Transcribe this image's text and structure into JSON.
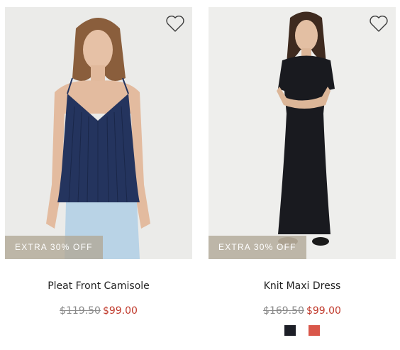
{
  "products": [
    {
      "badge": "EXTRA 30% OFF",
      "name": "Pleat Front Camisole",
      "original_price": "$119.50",
      "sale_price": "$99.00",
      "swatches": []
    },
    {
      "badge": "EXTRA 30% OFF",
      "name": "Knit Maxi Dress",
      "original_price": "$169.50",
      "sale_price": "$99.00",
      "swatches": [
        {
          "name": "black",
          "color": "#1d1f27"
        },
        {
          "name": "coral",
          "color": "#d9574a"
        }
      ]
    }
  ],
  "icons": {
    "wishlist": "heart-outline-icon"
  },
  "colors": {
    "sale": "#c0392b",
    "badge_bg": "#b2aa98"
  }
}
